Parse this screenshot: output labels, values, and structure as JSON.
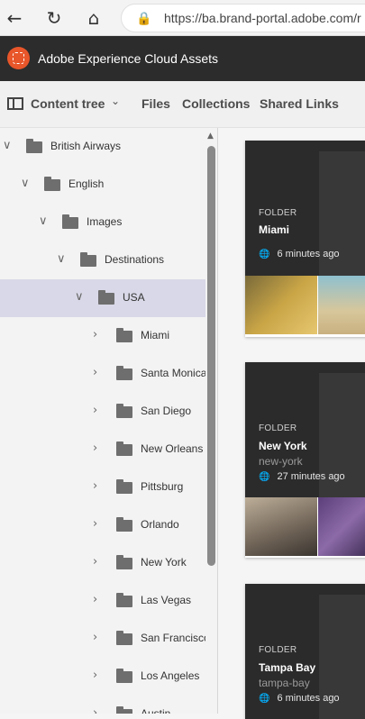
{
  "browser": {
    "url": "https://ba.brand-portal.adobe.com/r",
    "back_icon": "←",
    "reload_icon": "↻",
    "home_icon": "⌂",
    "lock_icon": "🔒"
  },
  "app": {
    "title": "Adobe Experience Cloud Assets",
    "brand_color": "#e8562a"
  },
  "toolbar": {
    "content_tree": "Content tree",
    "caret": "⌄",
    "files": "Files",
    "collections": "Collections",
    "shared_links": "Shared Links"
  },
  "tree": {
    "rows": [
      {
        "label": "British Airways",
        "chevron": "∨",
        "depth": 0,
        "selected": false
      },
      {
        "label": "English",
        "chevron": "∨",
        "depth": 1,
        "selected": false
      },
      {
        "label": "Images",
        "chevron": "∨",
        "depth": 2,
        "selected": false
      },
      {
        "label": "Destinations",
        "chevron": "∨",
        "depth": 3,
        "selected": false
      },
      {
        "label": "USA",
        "chevron": "∨",
        "depth": 4,
        "selected": true
      },
      {
        "label": "Miami",
        "chevron": "›",
        "depth": 5,
        "selected": false
      },
      {
        "label": "Santa Monica",
        "chevron": "›",
        "depth": 5,
        "selected": false
      },
      {
        "label": "San Diego",
        "chevron": "›",
        "depth": 5,
        "selected": false
      },
      {
        "label": "New Orleans",
        "chevron": "›",
        "depth": 5,
        "selected": false
      },
      {
        "label": "Pittsburg",
        "chevron": "›",
        "depth": 5,
        "selected": false
      },
      {
        "label": "Orlando",
        "chevron": "›",
        "depth": 5,
        "selected": false
      },
      {
        "label": "New York",
        "chevron": "›",
        "depth": 5,
        "selected": false
      },
      {
        "label": "Las Vegas",
        "chevron": "›",
        "depth": 5,
        "selected": false
      },
      {
        "label": "San Francisco",
        "chevron": "›",
        "depth": 5,
        "selected": false
      },
      {
        "label": "Los Angeles",
        "chevron": "›",
        "depth": 5,
        "selected": false
      },
      {
        "label": "Austin",
        "chevron": "›",
        "depth": 5,
        "selected": false
      }
    ]
  },
  "cards": [
    {
      "kind": "FOLDER",
      "name": "Miami",
      "slug": "",
      "time": "6 minutes ago",
      "globe": "🌐"
    },
    {
      "kind": "FOLDER",
      "name": "New York",
      "slug": "new-york",
      "time": "27 minutes ago",
      "globe": "🌐"
    },
    {
      "kind": "FOLDER",
      "name": "Tampa Bay",
      "slug": "tampa-bay",
      "time": "6 minutes ago",
      "globe": "🌐"
    }
  ]
}
